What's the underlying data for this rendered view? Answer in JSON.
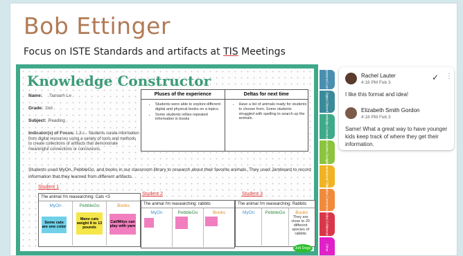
{
  "doc": {
    "title": "Bob Ettinger",
    "subtitle_pre": "Focus on ISTE Standards and artifacts at ",
    "subtitle_tis": "TIS",
    "subtitle_post": " Meetings"
  },
  "slide": {
    "heading": "Knowledge Constructor",
    "name_label": "Name:",
    "name_value": "Tamanh Le",
    "grade_label": "Grade:",
    "grade_value": "2nd",
    "subject_label": "Subject:",
    "subject_value": "Reading",
    "focus_label": "Indicator(s) of Focus:",
    "focus_text": "1.3.c - Students curate information from digital resources using a variety of tools and methods to create collections of artifacts that demonstrate meaningful connections or conclusions.",
    "table": {
      "pluses_header": "Pluses of the experience",
      "deltas_header": "Deltas for next time",
      "pluses": [
        "Students were able to explore different digital and physical books on a topics.",
        "Some students rellies repeated information in books"
      ],
      "deltas": [
        "Have a list of animals ready for students to choose from. Some students struggled with spelling to search up the animals."
      ]
    },
    "paragraph": "Students used MyOn, PebbleGo, and books in our classroom library to research about their favorite animals. They used Jamboard to record information that they learned from different artifacts.",
    "students": [
      {
        "label": "Student 1",
        "header": "The animal I'm reasearching: Cats <3",
        "cols": [
          "MyOn",
          "PebbleGo",
          "Books"
        ],
        "notes": [
          "Some cats are one color",
          "Manx cats weight 8 to 13 pounds",
          "Cat/Mitys can play with yarn"
        ]
      },
      {
        "label": "Student 2",
        "header": "The animal I'm reasearching: rabbits",
        "cols": [
          "MyOn",
          "PebbleGo",
          "Books"
        ]
      },
      {
        "label": "Student 3",
        "header": "The animal I'm reasearching: Rabbits",
        "cols": [
          "MyOn",
          "PebbleGo",
          "Books"
        ],
        "books_note": "They are close to 20 different species of rabbits",
        "green_note": "Jolt Dogs"
      }
    ],
    "tabs": [
      {
        "label": "Empowered Learner",
        "color": "#4a8fb0"
      },
      {
        "label": "Digital Citizen",
        "color": "#3a8a9a"
      },
      {
        "label": "Knowledge Constructor",
        "color": "#3fa98a"
      },
      {
        "label": "Innovative Designer",
        "color": "#8cc43f"
      },
      {
        "label": "Computational Thinker",
        "color": "#f0b323"
      },
      {
        "label": "Creative Communicator",
        "color": "#f08a3c"
      },
      {
        "label": "Global Collaborator",
        "color": "#d9364a"
      },
      {
        "label": "Other",
        "color": "#e020c8"
      }
    ]
  },
  "comments": [
    {
      "author": "Rachel Lauter",
      "time": "4:16 PM Feb 3",
      "text": "I like this format and idea!"
    },
    {
      "author": "Elizabeth Smith Gordon",
      "time": "4:18 PM Feb 3",
      "text": "Same! What a great way to have younger kids keep track of where they get their information."
    }
  ],
  "icons": {
    "resolve": "check-icon",
    "more": "more-vert-icon"
  }
}
